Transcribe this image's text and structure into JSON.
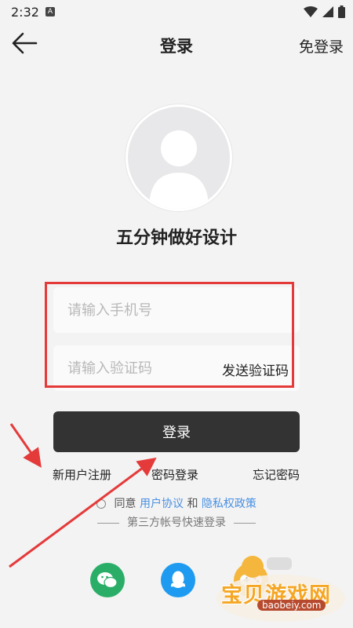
{
  "status_bar": {
    "time": "2:32",
    "notice_letter": "A"
  },
  "header": {
    "title": "登录",
    "skip_label": "免登录"
  },
  "app": {
    "name": "五分钟做好设计"
  },
  "form": {
    "phone_placeholder": "请输入手机号",
    "phone_value": "",
    "code_placeholder": "请输入验证码",
    "code_value": "",
    "send_code_label": "发送验证码",
    "login_label": "登录"
  },
  "links": {
    "register": "新用户注册",
    "password_login": "密码登录",
    "forgot_password": "忘记密码"
  },
  "agreement": {
    "prefix": "同意",
    "user_agreement": "用户协议",
    "and": "和",
    "privacy_policy": "隐私权政策"
  },
  "third_party": {
    "title": "第三方帐号快速登录",
    "icons": [
      "wechat-icon",
      "qq-icon",
      "game-controller-icon"
    ]
  },
  "watermark": {
    "text": "宝贝游戏网",
    "url": "baobeiy.com"
  },
  "colors": {
    "accent_red": "#e53a3a",
    "link_blue": "#4a90e2",
    "wechat_green": "#2aae67",
    "qq_blue": "#1e9bf0",
    "button_dark": "#333333"
  }
}
